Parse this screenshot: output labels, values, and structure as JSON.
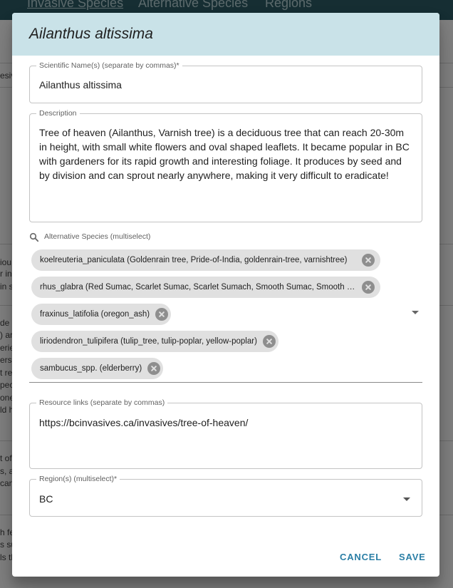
{
  "app": {
    "nav": [
      "Invasive Species",
      "Alternative Species",
      "Regions"
    ],
    "background_fragments": [
      "esiv",
      "iou",
      "r in",
      "in sp",
      "de n",
      ") ar",
      "erie",
      "ers",
      "t rep",
      "peci",
      "one",
      "ld h",
      "t of",
      "s, al",
      "can",
      "h fe",
      "s sur",
      "ls th"
    ]
  },
  "dialog": {
    "title": "Ailanthus altissima",
    "scientific_name": {
      "label": "Scientific Name(s) (separate by commas)*",
      "value": "Ailanthus altissima"
    },
    "description": {
      "label": "Description",
      "value": "Tree of heaven (Ailanthus, Varnish tree) is a deciduous tree that can reach 20-30m in height, with small white flowers and oval shaped leaflets. It became popular in BC with gardeners for its rapid growth and interesting foliage. It produces by seed and by division and can sprout nearly anywhere, making it very difficult to eradicate!"
    },
    "alternative_species": {
      "label": "Alternative Species (multiselect)",
      "icon": "search-icon",
      "chips": [
        "koelreuteria_paniculata (Goldenrain tree, Pride-of-India, goldenrain-tree, varnishtree)",
        "rhus_glabra (Red Sumac, Scarlet Sumac, Scarlet Sumach, Smooth Sumac, Smooth Sumach)",
        "fraxinus_latifolia (oregon_ash)",
        "liriodendron_tulipifera (tulip_tree, tulip-poplar, yellow-poplar)",
        "sambucus_spp. (elderberry)"
      ]
    },
    "resource_links": {
      "label": "Resource links (separate by commas)",
      "value": "https://bcinvasives.ca/invasives/tree-of-heaven/"
    },
    "regions": {
      "label": "Region(s) (multiselect)*",
      "value": "BC"
    },
    "actions": {
      "cancel": "CANCEL",
      "save": "SAVE"
    },
    "colors": {
      "header_bg": "#c9e2e8",
      "accent": "#2b7fa6",
      "chip_bg": "#e0e0e0",
      "topbar_bg": "#2c5c66"
    }
  }
}
